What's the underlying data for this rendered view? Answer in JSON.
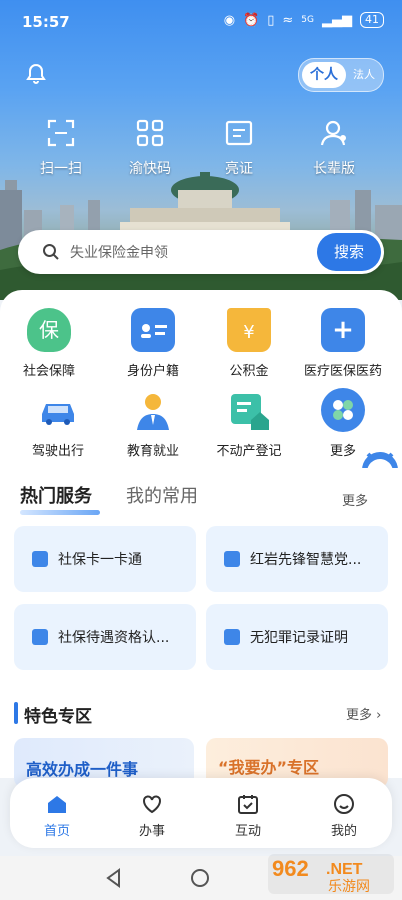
{
  "status": {
    "time": "15:57",
    "battery": "41",
    "net": "5G"
  },
  "header": {
    "toggle_on": "个人",
    "toggle_off": "法人"
  },
  "quick_actions": [
    {
      "label": "扫一扫",
      "icon": "scan-icon"
    },
    {
      "label": "渝快码",
      "icon": "qr-grid-icon"
    },
    {
      "label": "亮证",
      "icon": "id-card-icon"
    },
    {
      "label": "长辈版",
      "icon": "elder-user-icon"
    }
  ],
  "search": {
    "placeholder": "失业保险金申领",
    "button": "搜索"
  },
  "services": [
    {
      "label": "社会保障",
      "color": "#4cc38a",
      "icon": "shield-bao-icon"
    },
    {
      "label": "身份户籍",
      "color": "#3e86e8",
      "icon": "id-badge-icon"
    },
    {
      "label": "公积金",
      "color": "#f5b73b",
      "icon": "house-yen-icon"
    },
    {
      "label": "医疗医保医药",
      "color": "#3e86e8",
      "icon": "medical-cross-icon"
    },
    {
      "label": "驾驶出行",
      "color": "#3e86e8",
      "icon": "car-icon"
    },
    {
      "label": "教育就业",
      "color": "#3e86e8",
      "icon": "person-tie-icon"
    },
    {
      "label": "不动产登记",
      "color": "#3cc0a8",
      "icon": "property-doc-icon"
    },
    {
      "label": "更多",
      "color": "#3e86e8",
      "icon": "more-clover-icon"
    }
  ],
  "hot": {
    "tab_active": "热门服务",
    "tab_inactive": "我的常用",
    "more": "更多",
    "cards": [
      "社保卡一卡通",
      "红岩先锋智慧党...",
      "社保待遇资格认...",
      "无犯罪记录证明"
    ]
  },
  "feature": {
    "title": "特色专区",
    "more": "更多",
    "card1": "高效办成一件事",
    "card2": "“我要办”专区"
  },
  "tabbar": [
    {
      "label": "首页",
      "icon": "home-icon"
    },
    {
      "label": "办事",
      "icon": "heart-icon"
    },
    {
      "label": "互动",
      "icon": "calendar-check-icon"
    },
    {
      "label": "我的",
      "icon": "smile-face-icon"
    }
  ],
  "watermark": {
    "top": "962",
    "mid": ".NET",
    "bottom": "乐游网"
  }
}
